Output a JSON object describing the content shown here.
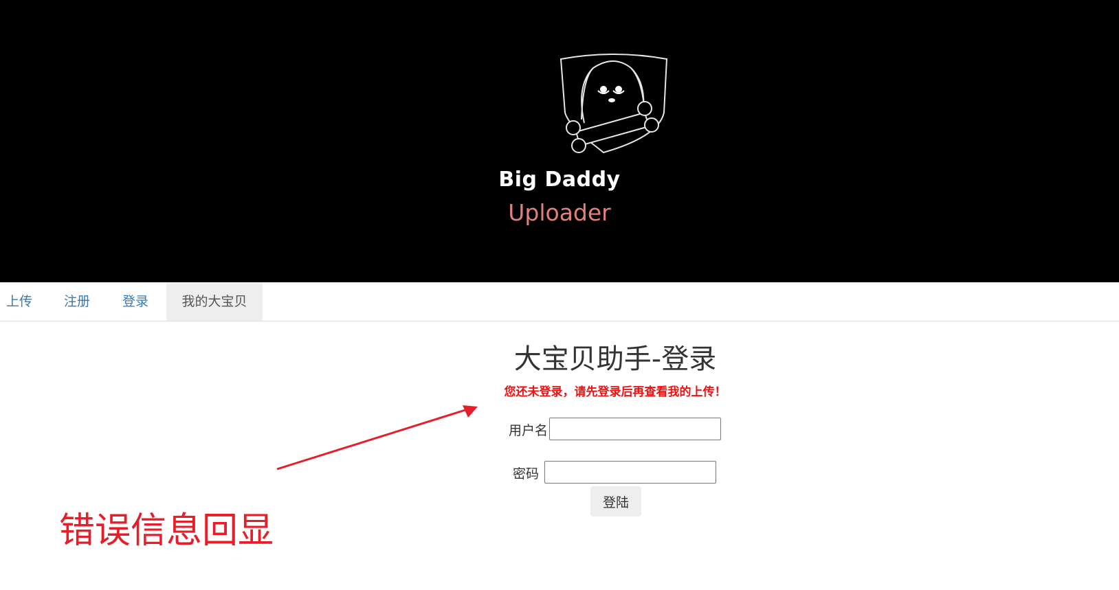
{
  "header": {
    "logo_name": "dog-with-bone-logo",
    "brand_line1": "Big Daddy",
    "brand_line2": "Uploader"
  },
  "nav": {
    "items": [
      {
        "label": "上传",
        "active": false
      },
      {
        "label": "注册",
        "active": false
      },
      {
        "label": "登录",
        "active": false
      },
      {
        "label": "我的大宝贝",
        "active": true
      }
    ]
  },
  "main": {
    "title": "大宝贝助手-登录",
    "error_message": "您还未登录，请先登录后再查看我的上传！",
    "form": {
      "username_label": "用户名",
      "username_value": "",
      "password_label": "密码",
      "password_value": "",
      "submit_label": "登陆"
    }
  },
  "annotation": {
    "text": "错误信息回显",
    "color": "#e61e2a"
  },
  "colors": {
    "header_bg": "#000000",
    "link": "#337ab7",
    "error": "#ee1111",
    "brand_accent": "#e0807f"
  }
}
